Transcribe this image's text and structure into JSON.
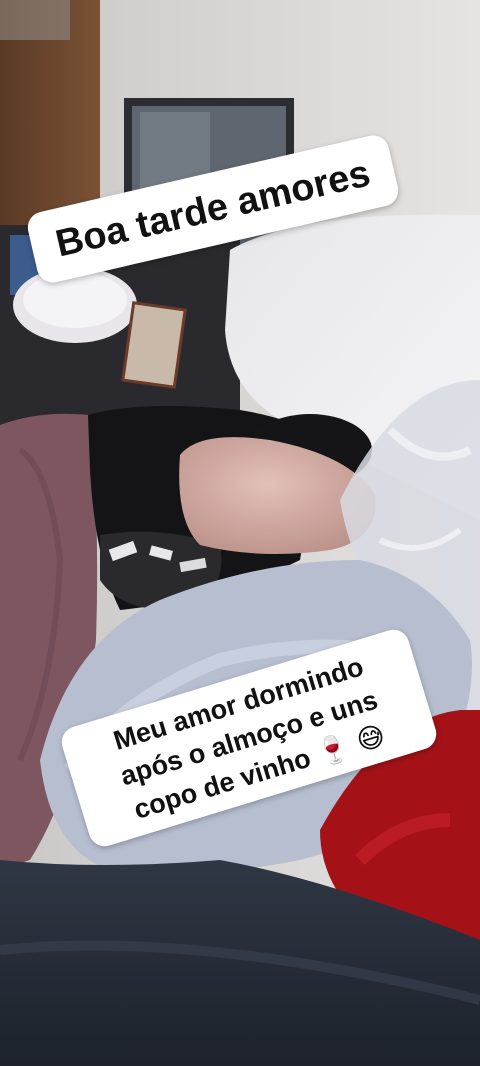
{
  "stickers": {
    "top": {
      "text": "Boa tarde amores"
    },
    "bottom": {
      "line1": "Meu amor dormindo",
      "line2_text": "após o almoço e uns",
      "line3_text": "copo de vinho",
      "line3_emojis": "🍷 😅"
    }
  }
}
